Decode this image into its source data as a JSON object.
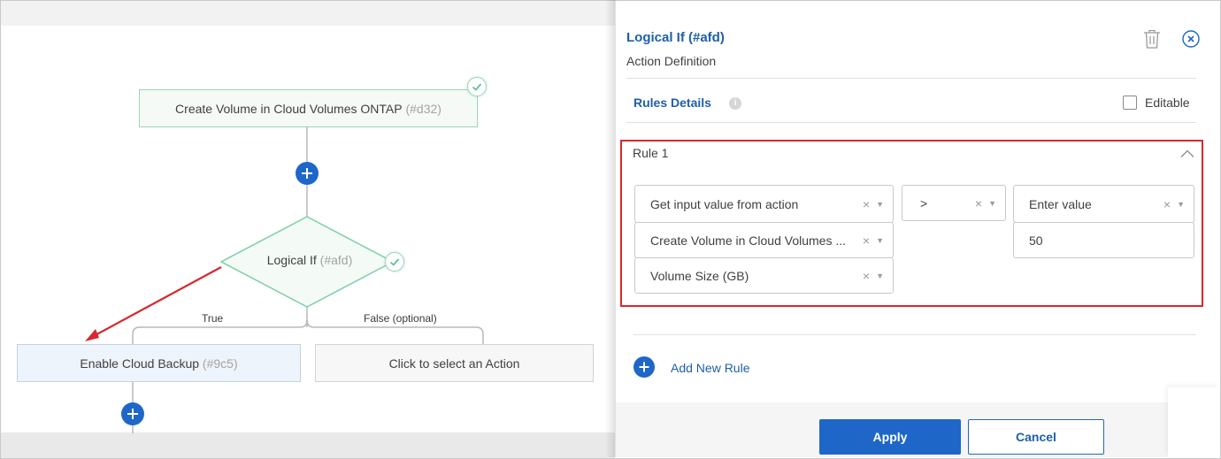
{
  "canvas": {
    "create_node": {
      "label": "Create Volume in Cloud Volumes ONTAP",
      "id": "(#d32)"
    },
    "logical_node": {
      "label": "Logical If",
      "id": "(#afd)"
    },
    "true_label": "True",
    "false_label": "False (optional)",
    "backup_node": {
      "label": "Enable Cloud Backup",
      "id": "(#9c5)"
    },
    "select_node": {
      "label": "Click to select an Action"
    }
  },
  "panel": {
    "title": "Logical If (#afd)",
    "subtitle": "Action Definition",
    "rules_details_label": "Rules Details",
    "info_glyph": "i",
    "editable_label": "Editable",
    "editable_checked": false,
    "rule": {
      "title": "Rule 1",
      "source_select": "Get input value from action",
      "action_select": "Create Volume in Cloud Volumes ...",
      "field_select": "Volume Size (GB)",
      "operator_select": ">",
      "value_type_select": "Enter value",
      "value_input": "50"
    },
    "clear_glyph": "×",
    "dropdown_glyph": "▼",
    "add_rule_label": "Add New Rule",
    "apply_label": "Apply",
    "cancel_label": "Cancel"
  },
  "colors": {
    "accent": "#1e67c8",
    "highlight": "#d7282f",
    "success": "#5ec28f"
  }
}
